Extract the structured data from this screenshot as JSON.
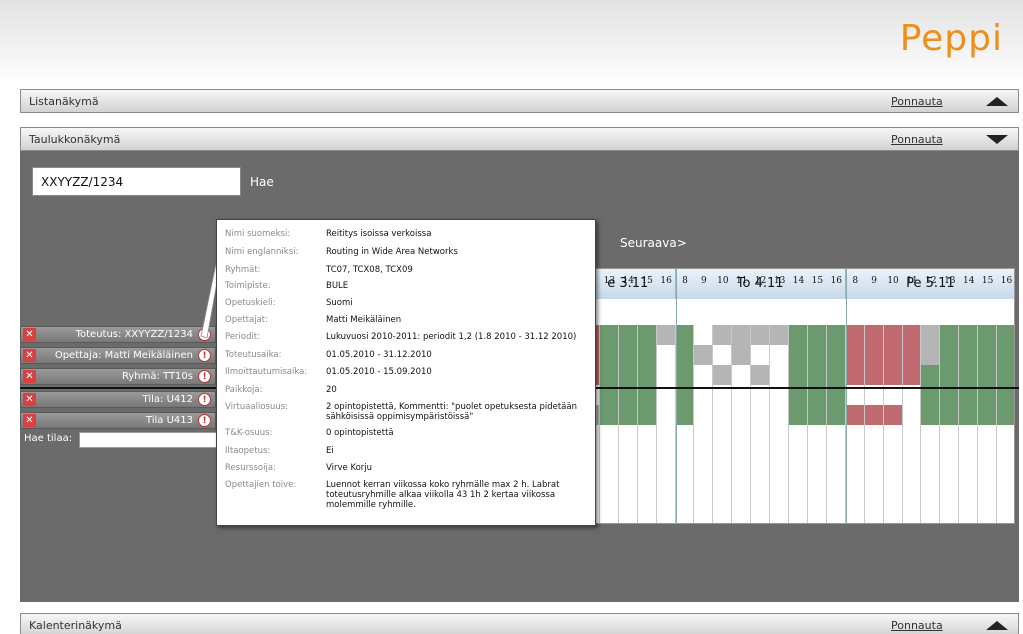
{
  "app": {
    "logo": "Peppi"
  },
  "panels": {
    "list": {
      "title": "Listanäkymä",
      "link": "Ponnauta"
    },
    "table": {
      "title": "Taulukkonäkymä",
      "link": "Ponnauta"
    },
    "calendar": {
      "title": "Kalenterinäkymä",
      "link": "Ponnauta"
    }
  },
  "search": {
    "value": "XXYYZZ/1234",
    "button": "Hae"
  },
  "nav": {
    "next": "Seuraava>"
  },
  "filters": [
    {
      "label": "Toteutus: XXYYZZ/1234"
    },
    {
      "label": "Opettaja: Matti Meikäläinen"
    },
    {
      "label": "Ryhmä: TT10s"
    },
    {
      "label": "Tila: U412"
    },
    {
      "label": "Tila U413"
    }
  ],
  "room_search": {
    "label": "Hae tilaa:"
  },
  "details": {
    "rows": [
      {
        "label": "Nimi suomeksi:",
        "value": "Reititys isoissa verkoissa"
      },
      {
        "label": "Nimi englanniksi:",
        "value": "Routing in Wide Area Networks"
      },
      {
        "label": "Ryhmät:",
        "value": "TC07, TCX08, TCX09"
      },
      {
        "label": "Toimipiste:",
        "value": "BULE"
      },
      {
        "label": "Opetuskieli:",
        "value": "Suomi"
      },
      {
        "label": "Opettajat:",
        "value": "Matti Meikäläinen"
      },
      {
        "label": "Periodit:",
        "value": "Lukuvuosi 2010-2011: periodit 1,2 (1.8 2010 - 31.12 2010)"
      },
      {
        "label": "Toteutusaika:",
        "value": "01.05.2010 - 31.12.2010"
      },
      {
        "label": "Ilmoittautumisaika:",
        "value": "01.05.2010 - 15.09.2010"
      },
      {
        "label": "Paikkoja:",
        "value": "20"
      },
      {
        "label": "Virtuaaliosuus:",
        "value": "2 opintopistettä, Kommentti: \"puolet opetuksesta pidetään sähköisissä oppimisympäristöissä\""
      },
      {
        "label": "T&K-osuus:",
        "value": "0 opintopistettä"
      },
      {
        "label": "Iltaopetus:",
        "value": "Ei"
      },
      {
        "label": "Resurssoija:",
        "value": "Virve Korju"
      },
      {
        "label": "Opettajien toive:",
        "value": "Luennot kerran viikossa koko ryhmälle max 2 h. Labrat toteutusryhmille alkaa viikolla 43 1h 2 kertaa viikossa molemmille ryhmille."
      }
    ]
  },
  "calendar": {
    "days": [
      {
        "label": "e 3.11",
        "hours": [
          "12",
          "13",
          "14",
          "15",
          "16"
        ]
      },
      {
        "label": "To 4.11",
        "hours": [
          "8",
          "9",
          "10",
          "11",
          "12",
          "13",
          "14",
          "15",
          "16"
        ]
      },
      {
        "label": "Pe 5.11",
        "hours": [
          "8",
          "9",
          "10",
          "11",
          "12",
          "13",
          "14",
          "15",
          "16"
        ]
      }
    ],
    "colors": {
      "busy": "#6a9a6e",
      "conflict": "#c06a70",
      "tentative": "#b5b5b5",
      "free": "#ffffff"
    },
    "rows": [
      [
        "conflict",
        "busy",
        "busy",
        "busy",
        "tentative",
        "busy",
        "free",
        "tentative",
        "tentative",
        "tentative",
        "tentative",
        "busy",
        "busy",
        "busy",
        "conflict",
        "conflict",
        "conflict",
        "conflict",
        "tentative",
        "busy",
        "busy",
        "busy",
        "busy"
      ],
      [
        "conflict",
        "busy",
        "busy",
        "busy",
        "free",
        "busy",
        "tentative",
        "free",
        "tentative",
        "free",
        "free",
        "busy",
        "busy",
        "busy",
        "conflict",
        "conflict",
        "conflict",
        "conflict",
        "tentative",
        "busy",
        "busy",
        "busy",
        "busy"
      ],
      [
        "conflict",
        "busy",
        "busy",
        "busy",
        "free",
        "busy",
        "free",
        "tentative",
        "free",
        "tentative",
        "free",
        "busy",
        "busy",
        "busy",
        "conflict",
        "conflict",
        "conflict",
        "conflict",
        "busy",
        "busy",
        "busy",
        "busy",
        "busy"
      ],
      [
        "free",
        "busy",
        "busy",
        "busy",
        "free",
        "busy",
        "free",
        "free",
        "free",
        "free",
        "free",
        "busy",
        "busy",
        "busy",
        "free",
        "free",
        "free",
        "free",
        "busy",
        "busy",
        "busy",
        "busy",
        "busy"
      ],
      [
        "tentative",
        "busy",
        "busy",
        "busy",
        "free",
        "busy",
        "free",
        "free",
        "free",
        "free",
        "free",
        "busy",
        "busy",
        "busy",
        "conflict",
        "conflict",
        "conflict",
        "free",
        "busy",
        "busy",
        "busy",
        "busy",
        "busy"
      ]
    ]
  }
}
